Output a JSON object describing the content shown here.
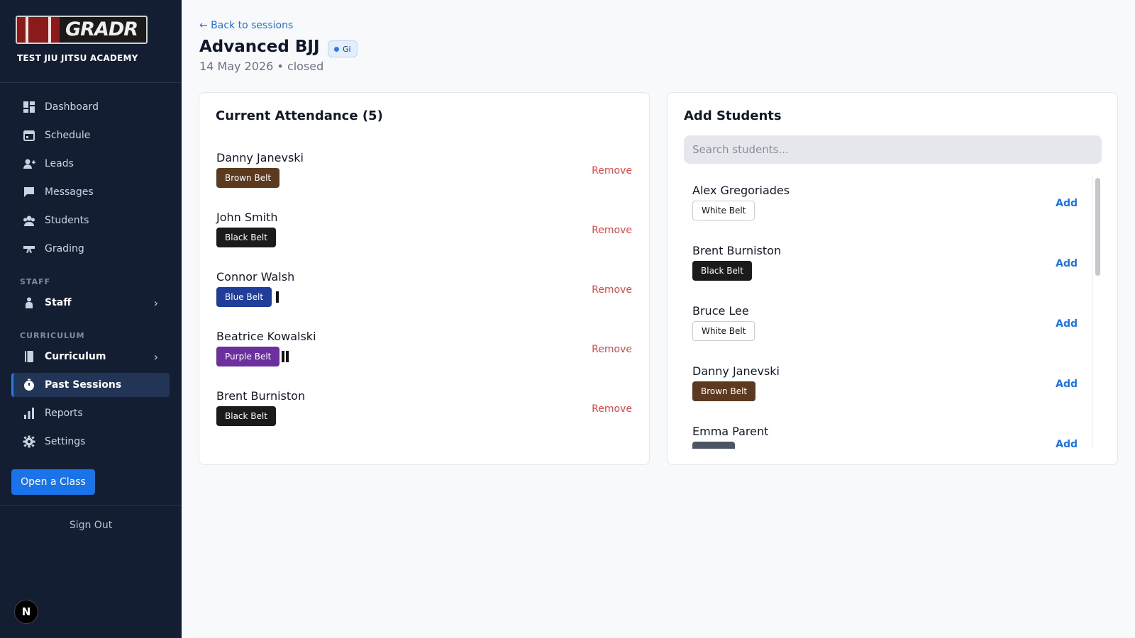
{
  "sidebar": {
    "logo_text": "GRADR",
    "academy": "TEST JIU JITSU ACADEMY",
    "items": [
      {
        "label": "Dashboard",
        "icon": "dashboard-icon"
      },
      {
        "label": "Schedule",
        "icon": "calendar-icon"
      },
      {
        "label": "Leads",
        "icon": "add-person-icon"
      },
      {
        "label": "Messages",
        "icon": "message-icon"
      },
      {
        "label": "Students",
        "icon": "group-icon"
      },
      {
        "label": "Grading",
        "icon": "belt-icon"
      }
    ],
    "staff_section": "STAFF",
    "staff_label": "Staff",
    "curriculum_section": "CURRICULUM",
    "curriculum_label": "Curriculum",
    "items_bottom": [
      {
        "label": "Past Sessions",
        "icon": "history-icon",
        "active": true
      },
      {
        "label": "Reports",
        "icon": "bar-chart-icon"
      },
      {
        "label": "Settings",
        "icon": "gear-icon"
      }
    ],
    "open_class": "Open a Class",
    "sign_out": "Sign Out",
    "avatar_letter": "N"
  },
  "header": {
    "back": "← Back to sessions",
    "title": "Advanced BJJ",
    "badge": "Gi",
    "subtitle": "14 May 2026 • closed"
  },
  "attendance": {
    "title": "Current Attendance (5)",
    "remove_label": "Remove",
    "rows": [
      {
        "name": "Danny Janevski",
        "belt": "Brown Belt",
        "stripes": 0
      },
      {
        "name": "John Smith",
        "belt": "Black Belt",
        "stripes": 0
      },
      {
        "name": "Connor Walsh",
        "belt": "Blue Belt",
        "stripes": 1
      },
      {
        "name": "Beatrice Kowalski",
        "belt": "Purple Belt",
        "stripes": 2
      },
      {
        "name": "Brent Burniston",
        "belt": "Black Belt",
        "stripes": 0
      }
    ]
  },
  "add_students": {
    "title": "Add Students",
    "search_placeholder": "Search students...",
    "add_label": "Add",
    "rows": [
      {
        "name": "Alex Gregoriades",
        "belt": "White Belt"
      },
      {
        "name": "Brent Burniston",
        "belt": "Black Belt"
      },
      {
        "name": "Bruce Lee",
        "belt": "White Belt"
      },
      {
        "name": "Danny Janevski",
        "belt": "Brown Belt"
      },
      {
        "name": "Emma Parent",
        "belt": ""
      }
    ]
  },
  "colors": {
    "brown": "#5b3a1f",
    "black": "#1b1b1b",
    "blue": "#1f3d99",
    "purple": "#6b2f9e",
    "white_border": "#c9ccd1",
    "accent": "#1a73e8"
  }
}
